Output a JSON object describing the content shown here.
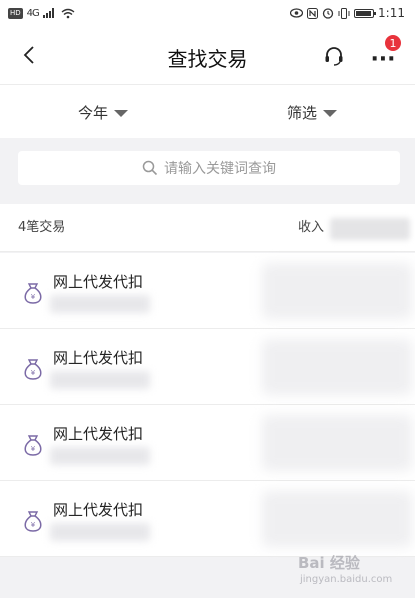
{
  "status_bar": {
    "hd": "HD",
    "network": "4G",
    "time": "1:11"
  },
  "header": {
    "title": "查找交易",
    "badge_count": "1",
    "icons": {
      "back": "chevron-left-icon",
      "service": "headset-icon",
      "more": "more-dots-icon"
    }
  },
  "filters": {
    "year_label": "今年",
    "screen_label": "筛选"
  },
  "search": {
    "placeholder": "请输入关键词查询"
  },
  "summary": {
    "count_label": "4笔交易",
    "income_label": "收入"
  },
  "transactions": [
    {
      "title": "网上代发代扣"
    },
    {
      "title": "网上代发代扣"
    },
    {
      "title": "网上代发代扣"
    },
    {
      "title": "网上代发代扣"
    }
  ],
  "watermark": {
    "main": "Bai 经验",
    "sub": "jingyan.baidu.com"
  },
  "colors": {
    "accent_badge": "#e8333c",
    "icon_purple": "#7b6aa6",
    "background": "#f2f2f4"
  }
}
